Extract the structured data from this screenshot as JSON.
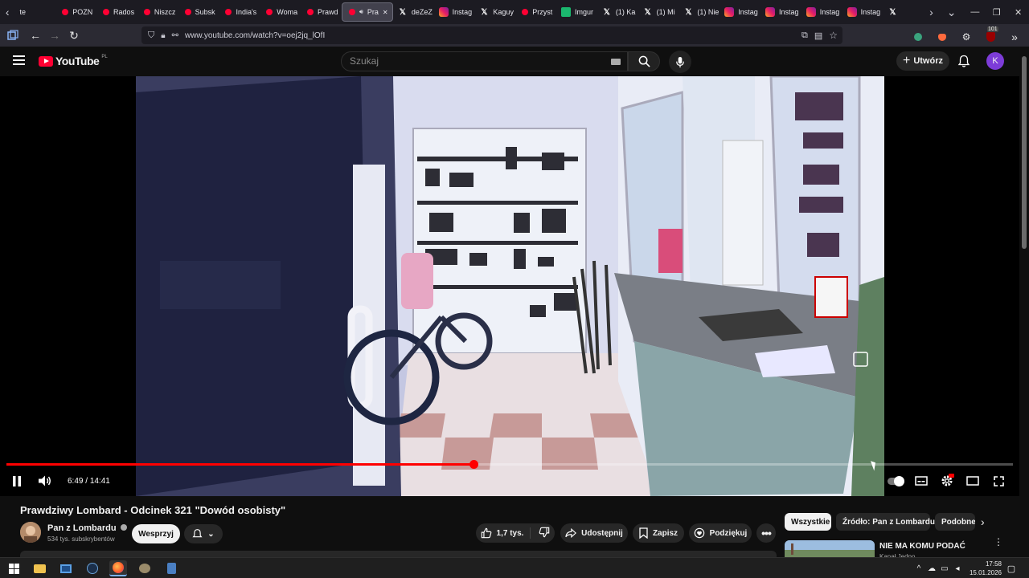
{
  "browser": {
    "tabs": [
      {
        "label": "te",
        "icon": "none"
      },
      {
        "label": "POZN",
        "icon": "youtube"
      },
      {
        "label": "Rados",
        "icon": "youtube"
      },
      {
        "label": "Niszcz",
        "icon": "youtube"
      },
      {
        "label": "Subsk",
        "icon": "youtube"
      },
      {
        "label": "India's",
        "icon": "youtube"
      },
      {
        "label": "Woma",
        "icon": "youtube"
      },
      {
        "label": "Prawd",
        "icon": "youtube"
      },
      {
        "label": "Pra",
        "icon": "youtube",
        "active": true
      },
      {
        "label": "deZeZ",
        "icon": "x"
      },
      {
        "label": "Instag",
        "icon": "instagram"
      },
      {
        "label": "Kaguy",
        "icon": "x"
      },
      {
        "label": "Przyst",
        "icon": "youtube"
      },
      {
        "label": "Imgur",
        "icon": "imgur"
      },
      {
        "label": "(1) Ka",
        "icon": "x"
      },
      {
        "label": "(1) Mi",
        "icon": "x"
      },
      {
        "label": "(1) Nie",
        "icon": "x"
      },
      {
        "label": "Instag",
        "icon": "instagram"
      },
      {
        "label": "Instag",
        "icon": "instagram"
      },
      {
        "label": "Instag",
        "icon": "instagram"
      },
      {
        "label": "Instag",
        "icon": "instagram"
      },
      {
        "label": "",
        "icon": "x"
      }
    ],
    "url": "www.youtube.com/watch?v=oej2jq_lOfI",
    "badge_count": "101"
  },
  "youtube": {
    "logo_text": "YouTube",
    "logo_region": "PL",
    "search_placeholder": "Szukaj",
    "create_label": "Utwórz",
    "avatar_letter": "K"
  },
  "player": {
    "time_current": "6:49",
    "time_total": "14:41",
    "progress_fraction": 0.4644
  },
  "video": {
    "title": "Prawdziwy Lombard - Odcinek 321 \"Dowód osobisty\"",
    "channel_name": "Pan z Lombardu",
    "subscribers": "534 tys. subskrybentów",
    "support_label": "Wesprzyj",
    "likes": "1,7 tys.",
    "share_label": "Udostępnij",
    "save_label": "Zapisz",
    "thanks_label": "Podziękuj"
  },
  "sidebar": {
    "chips": [
      "Wszystkie",
      "Źródło: Pan z Lombardu",
      "Podobne"
    ],
    "first_video_title": "NIE MA KOMU PODAĆ",
    "first_video_channel": "Kanał Jedno..."
  },
  "taskbar": {
    "time": "17:58",
    "date": "15.01.2026"
  },
  "colors": {
    "accent_red": "#ff0033",
    "progress": "#ff0000",
    "avatar": "#7d3cd8"
  }
}
